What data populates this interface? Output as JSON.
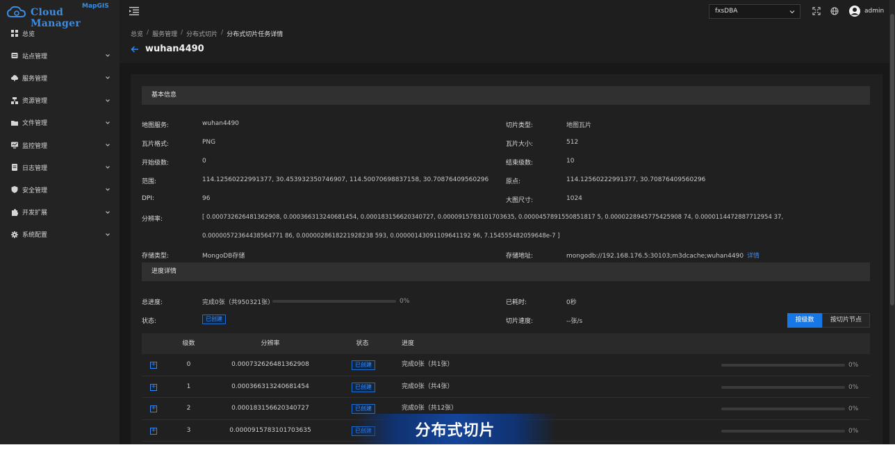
{
  "logo": {
    "brand": "Cloud Manager",
    "sub": "MapGIS"
  },
  "colors": {
    "accent": "#2f8cff",
    "sidebar_bg": "#232323",
    "content_bg": "#181818",
    "banner": "#1446a0"
  },
  "sidebar": {
    "items": [
      {
        "label": "总览",
        "icon": "grid-icon",
        "expandable": false
      },
      {
        "label": "站点管理",
        "icon": "site-icon",
        "expandable": true
      },
      {
        "label": "服务管理",
        "icon": "cloud-service-icon",
        "expandable": true
      },
      {
        "label": "资源管理",
        "icon": "resource-icon",
        "expandable": true
      },
      {
        "label": "文件管理",
        "icon": "folder-icon",
        "expandable": true
      },
      {
        "label": "监控管理",
        "icon": "monitor-icon",
        "expandable": true
      },
      {
        "label": "日志管理",
        "icon": "log-icon",
        "expandable": true
      },
      {
        "label": "安全管理",
        "icon": "shield-icon",
        "expandable": true
      },
      {
        "label": "开发扩展",
        "icon": "puzzle-icon",
        "expandable": true
      },
      {
        "label": "系统配置",
        "icon": "gear-icon",
        "expandable": true
      }
    ]
  },
  "header": {
    "db_select": "fxsDBA",
    "user": "admin"
  },
  "breadcrumb": [
    "总览",
    "服务管理",
    "分布式切片",
    "分布式切片任务详情"
  ],
  "page_title": "wuhan4490",
  "basic": {
    "title": "基本信息",
    "map_service_label": "地图服务:",
    "map_service": "wuhan4490",
    "tile_type_label": "切片类型:",
    "tile_type": "地图瓦片",
    "tile_format_label": "瓦片格式:",
    "tile_format": "PNG",
    "tile_size_label": "瓦片大小:",
    "tile_size": "512",
    "start_level_label": "开始级数:",
    "start_level": "0",
    "end_level_label": "结束级数:",
    "end_level": "10",
    "extent_label": "范围:",
    "extent": "114.12560222991377, 30.453932350746907, 114.50070698837158, 30.70876409560296",
    "origin_label": "原点:",
    "origin": "114.12560222991377, 30.70876409560296",
    "dpi_label": "DPI:",
    "dpi": "96",
    "big_tile_label": "大图尺寸:",
    "big_tile": "1024",
    "resolution_label": "分辨率:",
    "resolution_line1": "[ 0.000732626481362908, 0.000366313240681454, 0.000183156620340727, 0.0000915783101703635, 0.0000457891550851817 5, 0.0000228945775425908 74, 0.0000114472887712954 37,",
    "resolution_line2": "0.00000572364438564771 86, 0.0000028618221928238 593, 0.00000143091109641192 96, 7.154555482059648e-7 ]",
    "storage_type_label": "存储类型:",
    "storage_type": "MongoDB存储",
    "storage_addr_label": "存储地址:",
    "storage_addr": "mongodb://192.168.176.5:30103;m3dcache;wuhan4490",
    "detail_link": "详情"
  },
  "progress": {
    "title": "进度详情",
    "total_label": "总进度:",
    "total_text": "完成0张（共950321张）",
    "total_percent": "0%",
    "total_fraction": 0,
    "elapsed_label": "已耗时:",
    "elapsed": "0秒",
    "status_label": "状态:",
    "status": "已创建",
    "speed_label": "切片速度:",
    "speed": "--张/s",
    "btn_by_level": "按级数",
    "btn_by_node": "按切片节点"
  },
  "table": {
    "columns": [
      "级数",
      "分辨率",
      "状态",
      "进度"
    ],
    "rows": [
      {
        "level": "0",
        "resolution": "0.000732626481362908",
        "status": "已创建",
        "progress": "完成0张（共1张）",
        "percent": "0%",
        "fraction": 0
      },
      {
        "level": "1",
        "resolution": "0.000366313240681454",
        "status": "已创建",
        "progress": "完成0张（共4张）",
        "percent": "0%",
        "fraction": 0
      },
      {
        "level": "2",
        "resolution": "0.000183156620340727",
        "status": "已创建",
        "progress": "完成0张（共12张）",
        "percent": "0%",
        "fraction": 0
      },
      {
        "level": "3",
        "resolution": "0.0000915783101703635",
        "status": "已创建",
        "progress": "",
        "percent": "0%",
        "fraction": 0
      }
    ]
  },
  "banner": "分布式切片"
}
